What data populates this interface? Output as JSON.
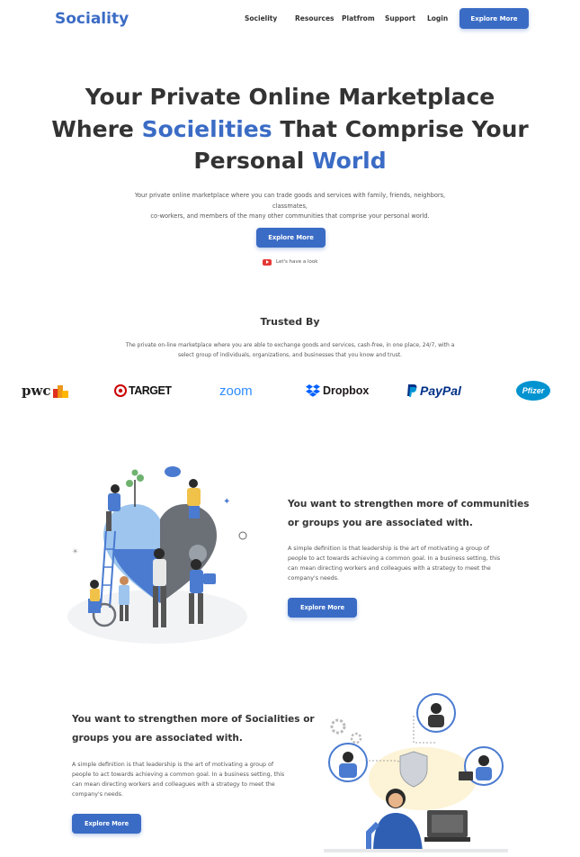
{
  "brand": {
    "name": "Sociality",
    "accent": "#3b6cc5"
  },
  "nav": {
    "links": [
      "Socielity",
      "Resources",
      "Platfrom",
      "Support",
      "Login"
    ],
    "cta": "Explore More"
  },
  "hero": {
    "title_l1": "Your Private Online Marketplace",
    "title_l2_a": "Where ",
    "title_l2_hl": "Socielities",
    "title_l2_b": " That Comprise Your",
    "title_l3_a": "Personal ",
    "title_l3_hl": "World",
    "subtitle_l1": "Your private online marketplace where you can trade goods and services with family, friends, neighbors, classmates,",
    "subtitle_l2": "co-workers, and members of the many other communities that comprise your personal world.",
    "cta": "Explore More",
    "look": "Let's have a look"
  },
  "trusted": {
    "title": "Trusted By",
    "subtitle_l1": "The private on-line marketplace where you are able to exchange goods and services, cash-free, in one place, 24/7, with a",
    "subtitle_l2": "select group of individuals, organizations, and businesses that you know and trust.",
    "logos": [
      "pwc",
      "TARGET",
      "zoom",
      "Dropbox",
      "PayPal",
      "Pfizer"
    ]
  },
  "feature1": {
    "title_l1": "You want to strengthen more of communities",
    "title_l2": "or groups you are associated with.",
    "body_l1": "A simple definition is that leadership is the art of motivating a group of",
    "body_l2": "people to act towards achieving a common goal. In a business setting, this",
    "body_l3": "can mean directing workers and colleagues with a strategy to meet the",
    "body_l4": "company's needs.",
    "cta": "Explore More"
  },
  "feature2": {
    "title_l1": "You want to strengthen more of Socialities or",
    "title_l2": "groups you are associated with.",
    "body_l1": "A simple definition is that leadership is the art of motivating a group of",
    "body_l2": "people to act towards achieving a common goal. In a business setting, this",
    "body_l3": "can mean directing workers and colleagues with a strategy to meet the",
    "body_l4": "company's needs.",
    "cta": "Explore More"
  }
}
